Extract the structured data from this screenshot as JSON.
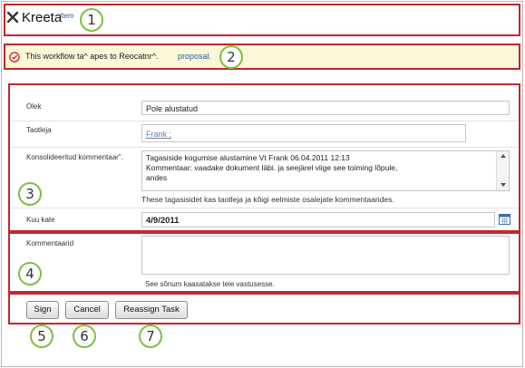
{
  "header": {
    "close_icon": "x-icon",
    "title": "Kreeta",
    "overlay_link": "Item"
  },
  "banner": {
    "icon": "workflow-status-icon",
    "text": "This workflow ta^ apes to Reocatnr^.",
    "link": "proposal."
  },
  "form": {
    "status": {
      "label": "Olek",
      "value": "Pole alustatud"
    },
    "requester": {
      "label": "Taotleja",
      "value": "Frank ;"
    },
    "consolidated": {
      "label": "Konsolideeritud kommentaar\".",
      "line1": "Tagasiside kogumise alustamine Vt Frank 06.04.2011 12:13",
      "line2": "Kommentaar: vaadake dokument läbi. ja seejärel viige see toiming lõpule,",
      "line3": "andes",
      "note": "These tagasisidet kas taotleja ja kõigi eelmiste osalejate kommentaarides."
    },
    "due_date": {
      "label": "Kuu kate",
      "value": "4/9/2011",
      "icon": "calendar-icon"
    },
    "comments": {
      "label": "Kommentaarid",
      "value": "",
      "note": "See sõnum kaasatakse teie vastusesse."
    }
  },
  "buttons": {
    "sign": "Sign",
    "cancel": "Cancel",
    "reassign": "Reassign Task"
  },
  "callouts": [
    "1",
    "2",
    "3",
    "4",
    "5",
    "6",
    "7"
  ],
  "colors": {
    "highlight": "#c0282e",
    "callout_ring": "#7fbf3f",
    "banner_bg": "#fdf7d9",
    "link": "#1f5da8"
  }
}
